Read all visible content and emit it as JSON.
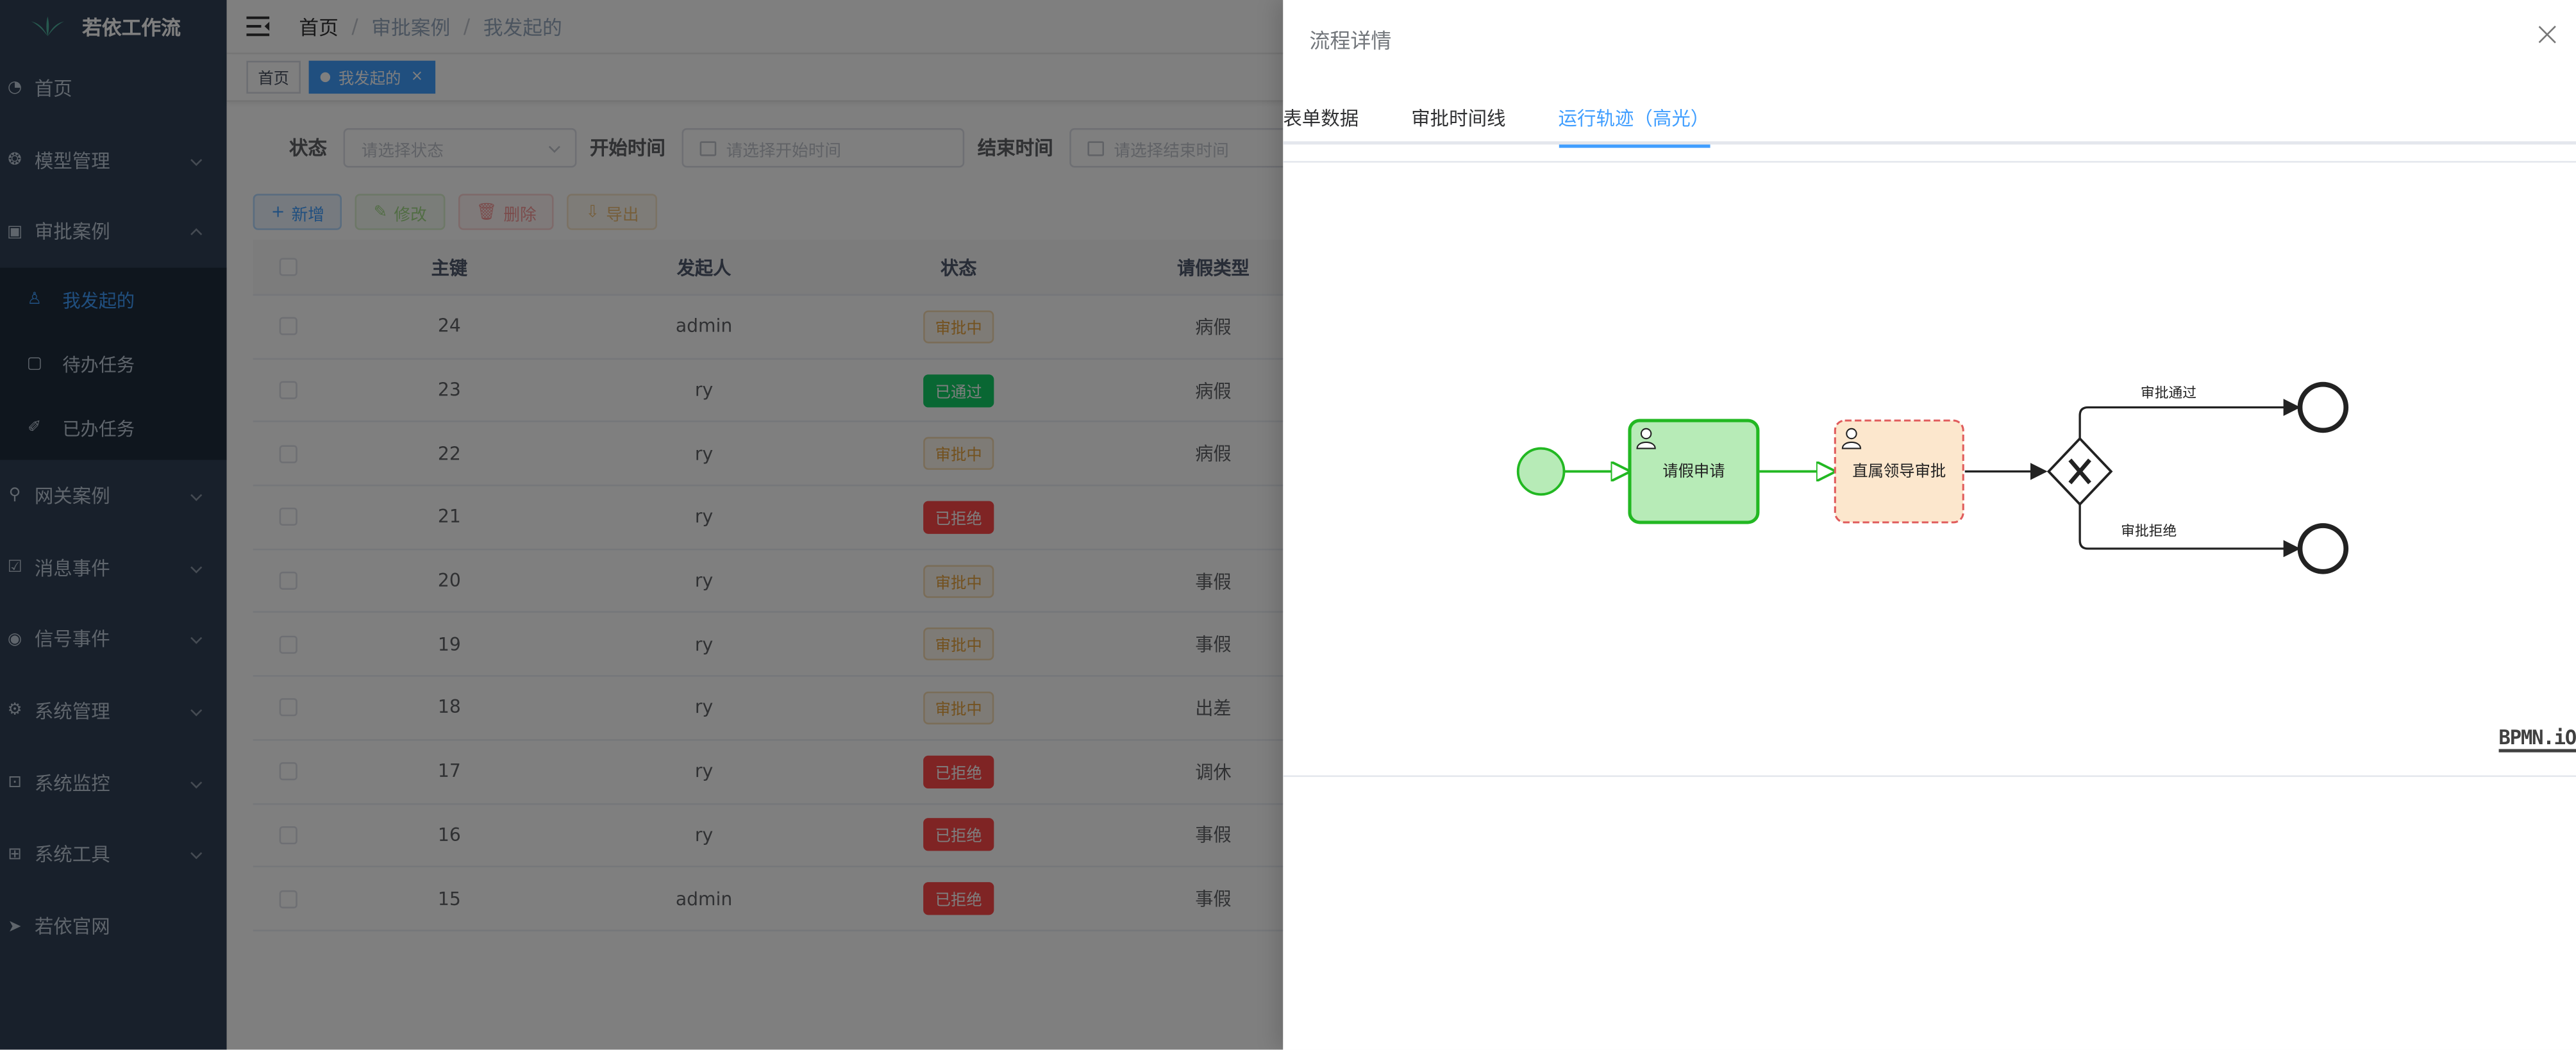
{
  "app": {
    "logo_text": "若依工作流"
  },
  "sidebar": {
    "items": [
      {
        "label": "首页",
        "icon": "dashboard-icon",
        "expandable": false
      },
      {
        "label": "模型管理",
        "icon": "model-icon",
        "expandable": true
      },
      {
        "label": "审批案例",
        "icon": "approval-icon",
        "expandable": true,
        "open": true
      },
      {
        "label": "网关案例",
        "icon": "gateway-icon",
        "expandable": true
      },
      {
        "label": "消息事件",
        "icon": "message-icon",
        "expandable": true
      },
      {
        "label": "信号事件",
        "icon": "signal-icon",
        "expandable": true
      },
      {
        "label": "系统管理",
        "icon": "gear-icon",
        "expandable": true
      },
      {
        "label": "系统监控",
        "icon": "monitor-icon",
        "expandable": true
      },
      {
        "label": "系统工具",
        "icon": "tool-icon",
        "expandable": true
      },
      {
        "label": "若依官网",
        "icon": "send-icon",
        "expandable": false
      }
    ],
    "submenu": [
      {
        "label": "我发起的",
        "icon": "user-icon",
        "active": true
      },
      {
        "label": "待办任务",
        "icon": "todo-icon",
        "active": false
      },
      {
        "label": "已办任务",
        "icon": "done-icon",
        "active": false
      }
    ]
  },
  "breadcrumb": [
    "首页",
    "审批案例",
    "我发起的"
  ],
  "tags": [
    {
      "label": "首页",
      "active": false
    },
    {
      "label": "我发起的",
      "active": true,
      "close": "×"
    }
  ],
  "filters": {
    "status_label": "状态",
    "status_placeholder": "请选择状态",
    "start_label": "开始时间",
    "start_placeholder": "请选择开始时间",
    "end_label": "结束时间",
    "end_placeholder": "请选择结束时间"
  },
  "toolbar": {
    "add": "新增",
    "edit": "修改",
    "delete": "删除",
    "export": "导出",
    "add_icon": "+",
    "edit_icon": "✎",
    "delete_icon": "🗑",
    "export_icon": "⇩"
  },
  "table": {
    "headers": [
      "主键",
      "发起人",
      "状态",
      "请假类型"
    ],
    "rows": [
      {
        "id": "24",
        "user": "admin",
        "status": "审批中",
        "status_type": "pending",
        "type": "病假"
      },
      {
        "id": "23",
        "user": "ry",
        "status": "已通过",
        "status_type": "passed",
        "type": "病假"
      },
      {
        "id": "22",
        "user": "ry",
        "status": "审批中",
        "status_type": "pending",
        "type": "病假"
      },
      {
        "id": "21",
        "user": "ry",
        "status": "已拒绝",
        "status_type": "rejected",
        "type": ""
      },
      {
        "id": "20",
        "user": "ry",
        "status": "审批中",
        "status_type": "pending",
        "type": "事假"
      },
      {
        "id": "19",
        "user": "ry",
        "status": "审批中",
        "status_type": "pending",
        "type": "事假"
      },
      {
        "id": "18",
        "user": "ry",
        "status": "审批中",
        "status_type": "pending",
        "type": "出差"
      },
      {
        "id": "17",
        "user": "ry",
        "status": "已拒绝",
        "status_type": "rejected",
        "type": "调休"
      },
      {
        "id": "16",
        "user": "ry",
        "status": "已拒绝",
        "status_type": "rejected",
        "type": "事假"
      },
      {
        "id": "15",
        "user": "admin",
        "status": "已拒绝",
        "status_type": "rejected",
        "type": "事假"
      }
    ]
  },
  "drawer": {
    "title": "流程详情",
    "tabs": [
      {
        "label": "表单数据",
        "active": false
      },
      {
        "label": "审批时间线",
        "active": false
      },
      {
        "label": "运行轨迹（高光）",
        "active": true
      }
    ],
    "bpmn_logo": "BPMN.iO"
  },
  "diagram": {
    "task1": "请假申请",
    "task2": "直属领导审批",
    "flow_approve": "审批通过",
    "flow_reject": "审批拒绝",
    "colors": {
      "completed_fill": "#b7ebb7",
      "completed_stroke": "#22b822",
      "current_fill": "#fce7cd",
      "current_stroke": "#e05c5c",
      "flow": "#22b822"
    }
  }
}
